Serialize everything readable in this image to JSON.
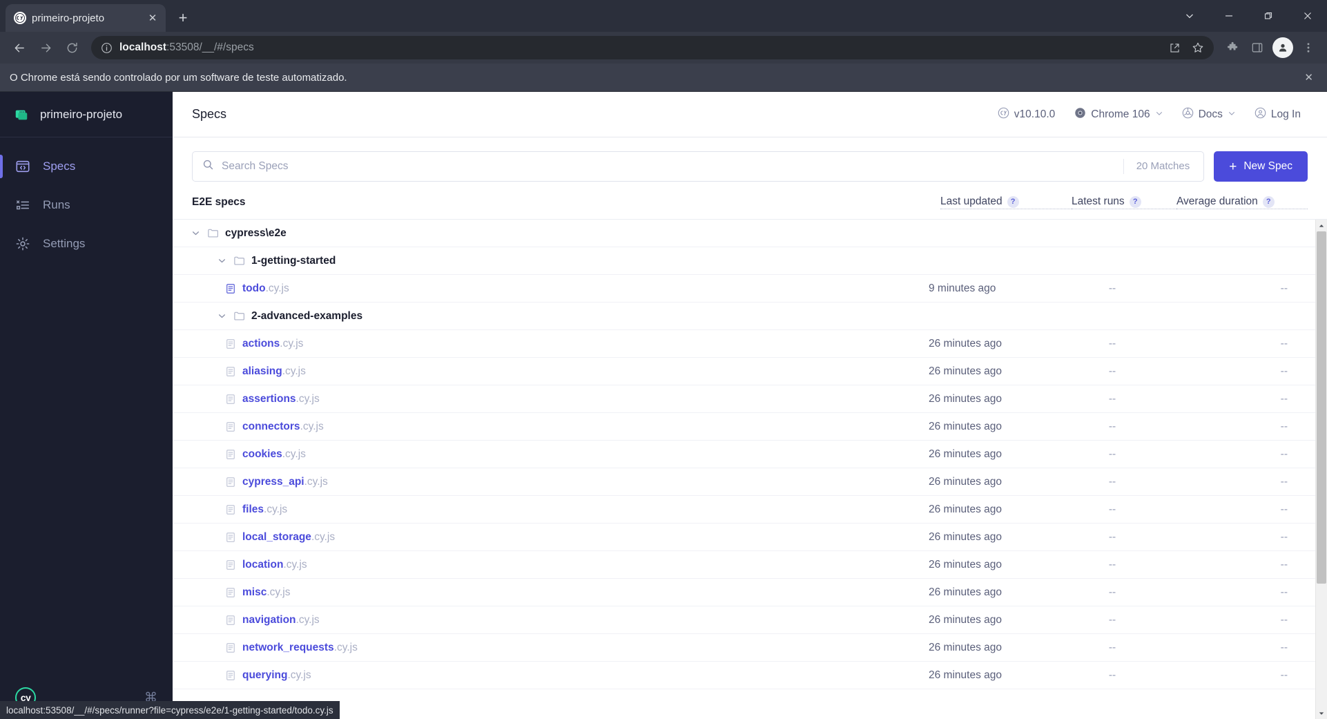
{
  "browser": {
    "tab": {
      "title": "primeiro-projeto",
      "favicon": "cypress-favicon",
      "close_label": "✕"
    },
    "newtab_label": "+",
    "window_controls": {
      "expand": "chevron-down-icon",
      "minimize": "minimize-icon",
      "restore": "restore-icon",
      "close": "close-icon"
    },
    "nav": {
      "back": "back-arrow-icon",
      "forward": "forward-arrow-icon",
      "reload": "reload-icon"
    },
    "omnibox": {
      "info_icon": "info-circle-icon",
      "url_host": "localhost",
      "url_rest": ":53508/__/#/specs",
      "share_icon": "share-icon",
      "bookmark_icon": "star-icon"
    },
    "toolbar_icons": {
      "extensions": "puzzle-icon",
      "sidepanel": "side-panel-icon",
      "profile": "avatar-icon",
      "menu": "three-dot-menu-icon"
    },
    "infobar": {
      "message": "O Chrome está sendo controlado por um software de teste automatizado.",
      "close_label": "✕"
    },
    "status_bar": {
      "url": "localhost:53508/__/#/specs/runner?file=cypress/e2e/1-getting-started/todo.cy.js"
    }
  },
  "sidebar": {
    "project_name": "primeiro-projeto",
    "project_icon": "cypress-project-icon",
    "items": [
      {
        "label": "Specs",
        "icon": "specs-icon",
        "active": true
      },
      {
        "label": "Runs",
        "icon": "runs-icon",
        "active": false
      },
      {
        "label": "Settings",
        "icon": "gear-icon",
        "active": false
      }
    ],
    "footer": {
      "logo": "cy",
      "keyboard_icon": "⌘"
    }
  },
  "header": {
    "title": "Specs",
    "version": {
      "label": "v10.10.0",
      "icon": "cypress-logo-icon"
    },
    "browser": {
      "label": "Chrome 106",
      "icon": "chrome-icon",
      "caret": "⌄"
    },
    "docs": {
      "label": "Docs",
      "icon": "docs-icon",
      "caret": "⌄"
    },
    "login": {
      "label": "Log In",
      "icon": "user-circle-icon"
    }
  },
  "search": {
    "placeholder": "Search Specs",
    "value": "",
    "icon": "search-icon",
    "matches": "20 Matches"
  },
  "new_spec_button": {
    "label": "New Spec",
    "plus": "+"
  },
  "table": {
    "name_header": "E2E specs",
    "columns": [
      {
        "label": "Last updated",
        "help": "?"
      },
      {
        "label": "Latest runs",
        "help": "?"
      },
      {
        "label": "Average duration",
        "help": "?"
      }
    ],
    "rows": [
      {
        "type": "folder",
        "indent": 0,
        "label": "cypress\\e2e",
        "chevron": "⌄"
      },
      {
        "type": "folder",
        "indent": 1,
        "label": "1-getting-started",
        "chevron": "⌄"
      },
      {
        "type": "spec",
        "indent": 2,
        "base": "todo",
        "ext": ".cy.js",
        "highlighted": true,
        "last_updated": "9 minutes ago",
        "latest_runs": "--",
        "average_duration": "--"
      },
      {
        "type": "folder",
        "indent": 1,
        "label": "2-advanced-examples",
        "chevron": "⌄"
      },
      {
        "type": "spec",
        "indent": 2,
        "base": "actions",
        "ext": ".cy.js",
        "highlighted": false,
        "last_updated": "26 minutes ago",
        "latest_runs": "--",
        "average_duration": "--"
      },
      {
        "type": "spec",
        "indent": 2,
        "base": "aliasing",
        "ext": ".cy.js",
        "highlighted": false,
        "last_updated": "26 minutes ago",
        "latest_runs": "--",
        "average_duration": "--"
      },
      {
        "type": "spec",
        "indent": 2,
        "base": "assertions",
        "ext": ".cy.js",
        "highlighted": false,
        "last_updated": "26 minutes ago",
        "latest_runs": "--",
        "average_duration": "--"
      },
      {
        "type": "spec",
        "indent": 2,
        "base": "connectors",
        "ext": ".cy.js",
        "highlighted": false,
        "last_updated": "26 minutes ago",
        "latest_runs": "--",
        "average_duration": "--"
      },
      {
        "type": "spec",
        "indent": 2,
        "base": "cookies",
        "ext": ".cy.js",
        "highlighted": false,
        "last_updated": "26 minutes ago",
        "latest_runs": "--",
        "average_duration": "--"
      },
      {
        "type": "spec",
        "indent": 2,
        "base": "cypress_api",
        "ext": ".cy.js",
        "highlighted": false,
        "last_updated": "26 minutes ago",
        "latest_runs": "--",
        "average_duration": "--"
      },
      {
        "type": "spec",
        "indent": 2,
        "base": "files",
        "ext": ".cy.js",
        "highlighted": false,
        "last_updated": "26 minutes ago",
        "latest_runs": "--",
        "average_duration": "--"
      },
      {
        "type": "spec",
        "indent": 2,
        "base": "local_storage",
        "ext": ".cy.js",
        "highlighted": false,
        "last_updated": "26 minutes ago",
        "latest_runs": "--",
        "average_duration": "--"
      },
      {
        "type": "spec",
        "indent": 2,
        "base": "location",
        "ext": ".cy.js",
        "highlighted": false,
        "last_updated": "26 minutes ago",
        "latest_runs": "--",
        "average_duration": "--"
      },
      {
        "type": "spec",
        "indent": 2,
        "base": "misc",
        "ext": ".cy.js",
        "highlighted": false,
        "last_updated": "26 minutes ago",
        "latest_runs": "--",
        "average_duration": "--"
      },
      {
        "type": "spec",
        "indent": 2,
        "base": "navigation",
        "ext": ".cy.js",
        "highlighted": false,
        "last_updated": "26 minutes ago",
        "latest_runs": "--",
        "average_duration": "--"
      },
      {
        "type": "spec",
        "indent": 2,
        "base": "network_requests",
        "ext": ".cy.js",
        "highlighted": false,
        "last_updated": "26 minutes ago",
        "latest_runs": "--",
        "average_duration": "--"
      },
      {
        "type": "spec",
        "indent": 2,
        "base": "querying",
        "ext": ".cy.js",
        "highlighted": false,
        "last_updated": "26 minutes ago",
        "latest_runs": "--",
        "average_duration": "--"
      }
    ]
  },
  "colors": {
    "accent": "#4b4bdb",
    "sidebar_bg": "#1b1e2e",
    "active_item": "#9f9ff0",
    "brand_green": "#2cd9a3",
    "chrome_toolbar": "#353945"
  }
}
